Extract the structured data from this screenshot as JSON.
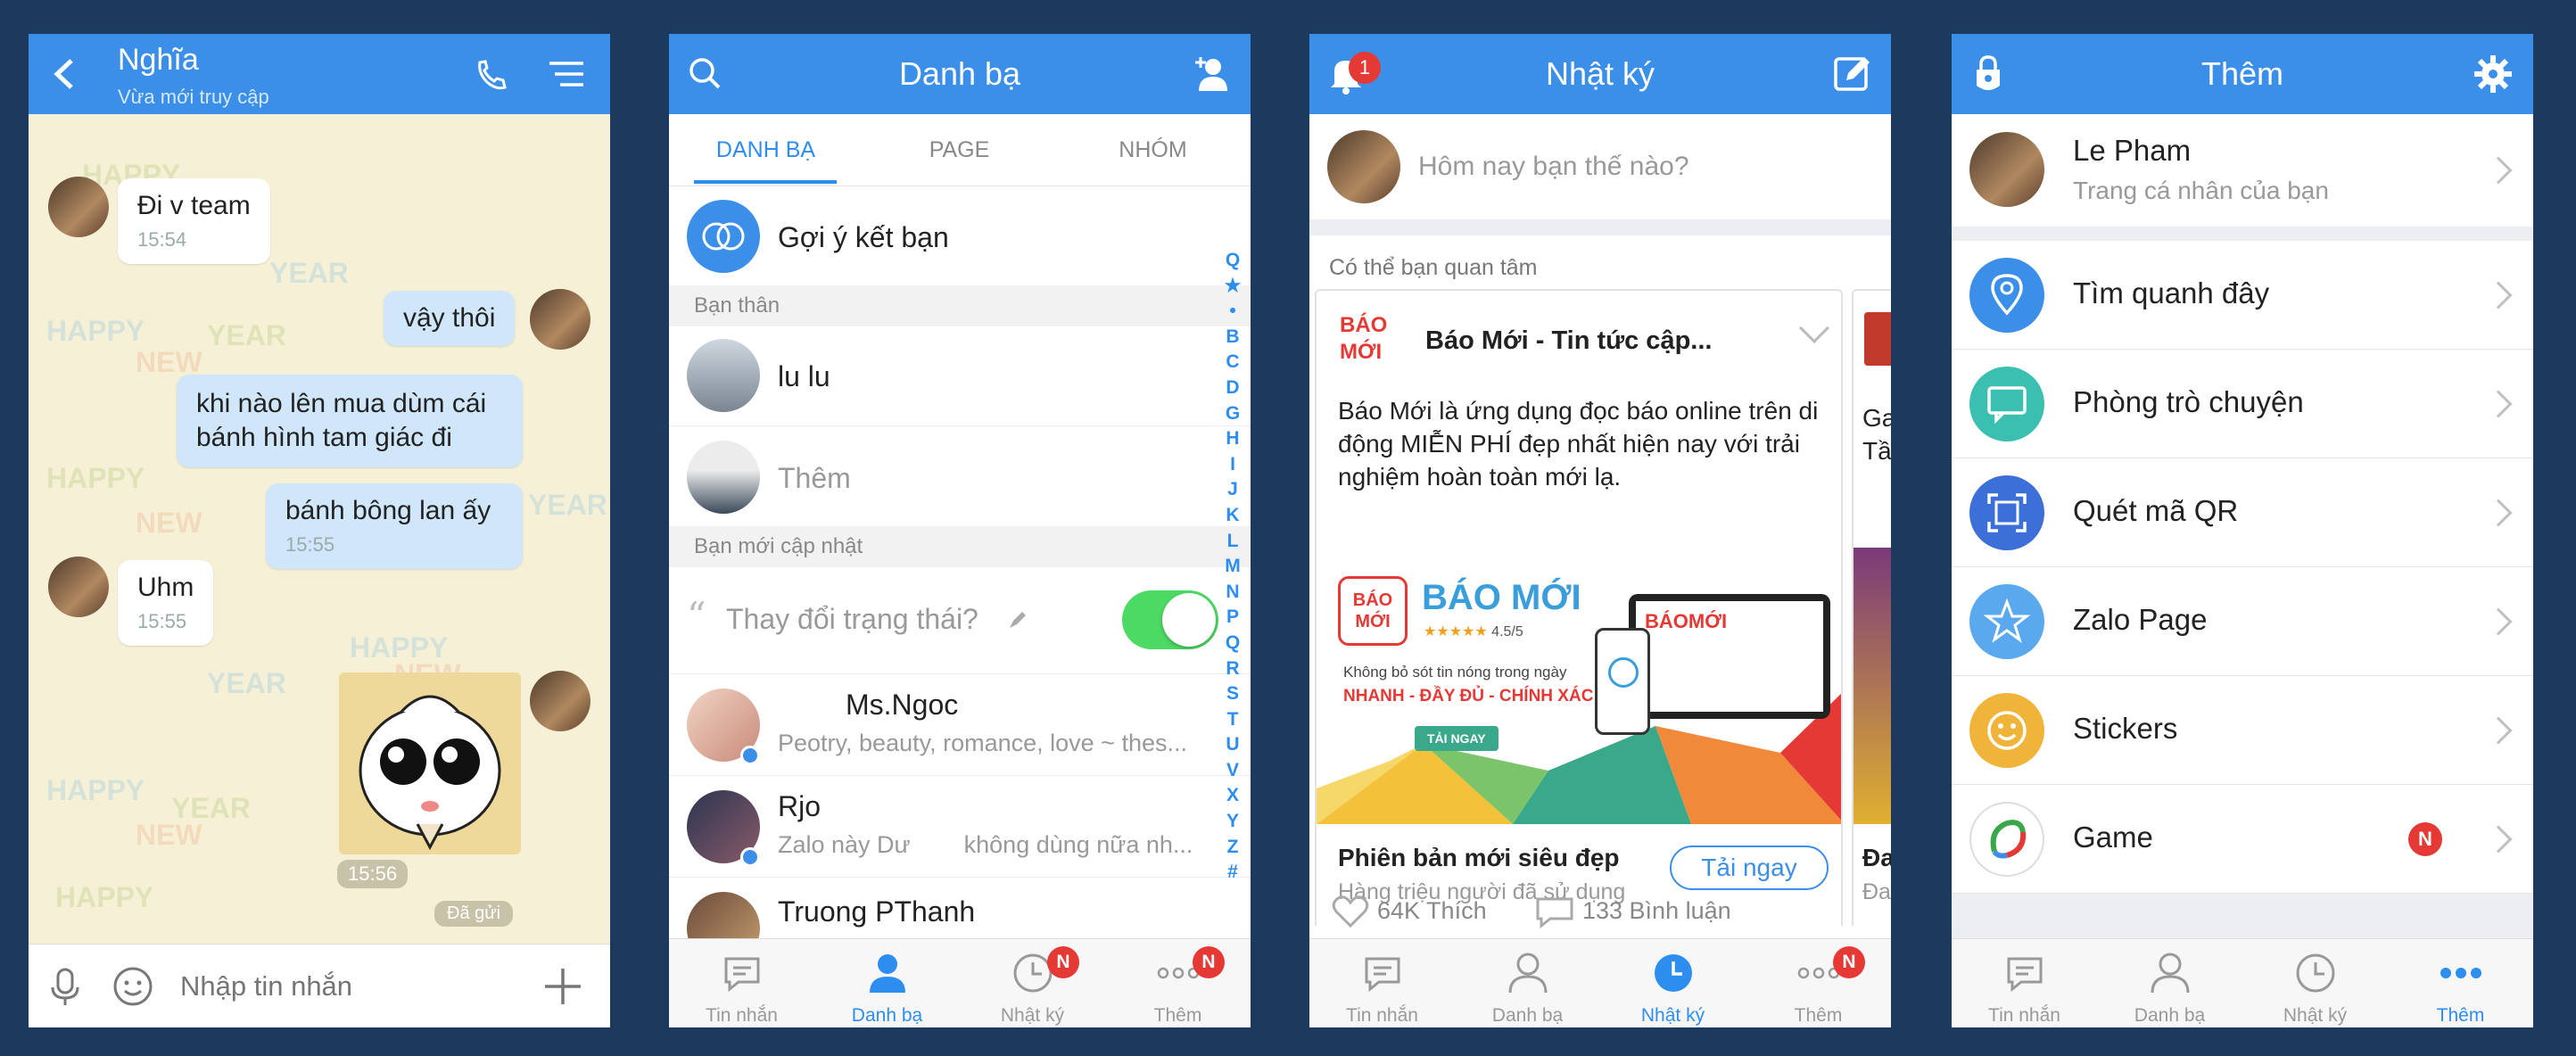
{
  "chat": {
    "name": "Nghĩa",
    "status": "Vừa mới truy cập",
    "messages": [
      {
        "text": "Đi v team",
        "time": "15:54"
      },
      {
        "text": "vậy thôi"
      },
      {
        "text": "khi nào lên mua dùm cái bánh hình tam giác đi"
      },
      {
        "text": "bánh bông lan ấy",
        "time": "15:55"
      },
      {
        "text": "Uhm",
        "time": "15:55"
      },
      {
        "time": "15:56"
      }
    ],
    "sent_label": "Đã gửi",
    "input_placeholder": "Nhập tin nhắn",
    "watermarks": [
      "HAPPY",
      "NEW",
      "YEAR"
    ]
  },
  "contacts": {
    "title": "Danh bạ",
    "tabs": [
      "DANH BẠ",
      "PAGE",
      "NHÓM"
    ],
    "suggest": "Gợi ý kết bạn",
    "section_friends": "Bạn thân",
    "friends": [
      "lu lu",
      "Thêm"
    ],
    "section_updates": "Bạn mới cập nhật",
    "status_prompt": "Thay đổi trạng thái?",
    "toggle_on": true,
    "updates": [
      {
        "name": "Ms.Ngoc",
        "sub": "Peotry, beauty, romance, love ~ thes..."
      },
      {
        "name": "Rjo",
        "sub": "Zalo này Dư        không dùng nữa nh..."
      },
      {
        "name": "Truong PThanh"
      }
    ],
    "alphabet": [
      "Q",
      "★",
      "•",
      "B",
      "C",
      "D",
      "G",
      "H",
      "I",
      "J",
      "K",
      "L",
      "M",
      "N",
      "P",
      "Q",
      "R",
      "S",
      "T",
      "U",
      "V",
      "X",
      "Y",
      "Z",
      "#"
    ]
  },
  "diary": {
    "title": "Nhật ký",
    "notif_count": "1",
    "prompt": "Hôm nay bạn thế nào?",
    "interest": "Có thể bạn quan tâm",
    "card": {
      "logo_line1": "BÁO",
      "logo_line2": "MỚI",
      "title": "Báo Mới - Tin tức cập...",
      "desc": "Báo Mới là ứng dụng đọc báo online trên di động MIỄN PHÍ đẹp nhất hiện nay với trải nghiệm hoàn toàn mới lạ.",
      "banner_brand": "BÁO MỚI",
      "banner_rating": "4.5/5",
      "banner_tag1": "Không bỏ sót tin nóng trong ngày",
      "banner_tag2": "NHANH - ĐẦY ĐỦ - CHÍNH XÁC",
      "banner_btn": "TẢI NGAY",
      "screen_brand": "BÁOMỚI",
      "promo_title": "Phiên bản mới siêu đẹp",
      "promo_sub": "Hàng triệu người đã sử dụng",
      "cta": "Tải ngay",
      "likes": "64K Thích",
      "comments": "133 Bình luận"
    },
    "side_card": {
      "line1": "Ga",
      "line2": "Tầ",
      "footer": "Đa",
      "footer2": "Đa"
    }
  },
  "more": {
    "title": "Thêm",
    "profile_name": "Le Pham",
    "profile_sub": "Trang cá nhân của bạn",
    "items": [
      {
        "label": "Tìm quanh đây",
        "icon": "location-pin-icon",
        "color": "#3b8fe8"
      },
      {
        "label": "Phòng trò chuyện",
        "icon": "chat-room-icon",
        "color": "#3bbfb0"
      },
      {
        "label": "Quét mã QR",
        "icon": "qr-scan-icon",
        "color": "#3d6fd8"
      },
      {
        "label": "Zalo Page",
        "icon": "star-icon",
        "color": "#5aa8ee"
      },
      {
        "label": "Stickers",
        "icon": "smiley-icon",
        "color": "#f0b43a"
      },
      {
        "label": "Game",
        "icon": "game-icon",
        "color": "#ffffff",
        "badge": "N"
      }
    ]
  },
  "tabbar": {
    "labels": [
      "Tin nhắn",
      "Danh bạ",
      "Nhật ký",
      "Thêm"
    ],
    "badge": "N"
  },
  "colors": {
    "accent": "#3b8fe8",
    "background": "#1b3a5d",
    "badge": "#e53935",
    "toggle": "#4cd964"
  }
}
